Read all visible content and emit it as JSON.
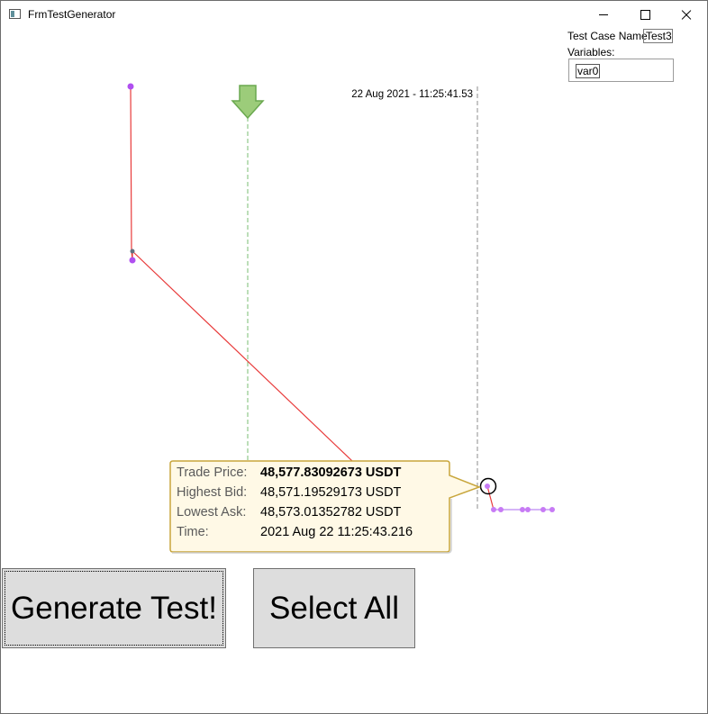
{
  "window": {
    "title": "FrmTestGenerator"
  },
  "controls": {
    "test_case_label": "Test Case Name",
    "test_case_value": "Test3",
    "variables_label": "Variables:",
    "variables": [
      "var0"
    ]
  },
  "chart": {
    "time_marker_label": "22 Aug 2021 - 11:25:41.53",
    "line_color": "#e83a3a",
    "point_color": "#b04ff0",
    "secondary_line_color": "#c79cf5",
    "marker_line_color": "#8fc78a",
    "cursor_line_color": "#a0a0a0"
  },
  "tooltip": {
    "rows": [
      {
        "label": "Trade Price:",
        "value": "48,577.83092673 USDT",
        "bold": true
      },
      {
        "label": "Highest Bid:",
        "value": "48,571.19529173 USDT",
        "bold": false
      },
      {
        "label": "Lowest Ask:",
        "value": "48,573.01352782 USDT",
        "bold": false
      },
      {
        "label": "Time:",
        "value": "2021 Aug 22 11:25:43.216",
        "bold": false
      }
    ]
  },
  "buttons": {
    "generate_label": "Generate Test!",
    "select_all_label": "Select All"
  }
}
